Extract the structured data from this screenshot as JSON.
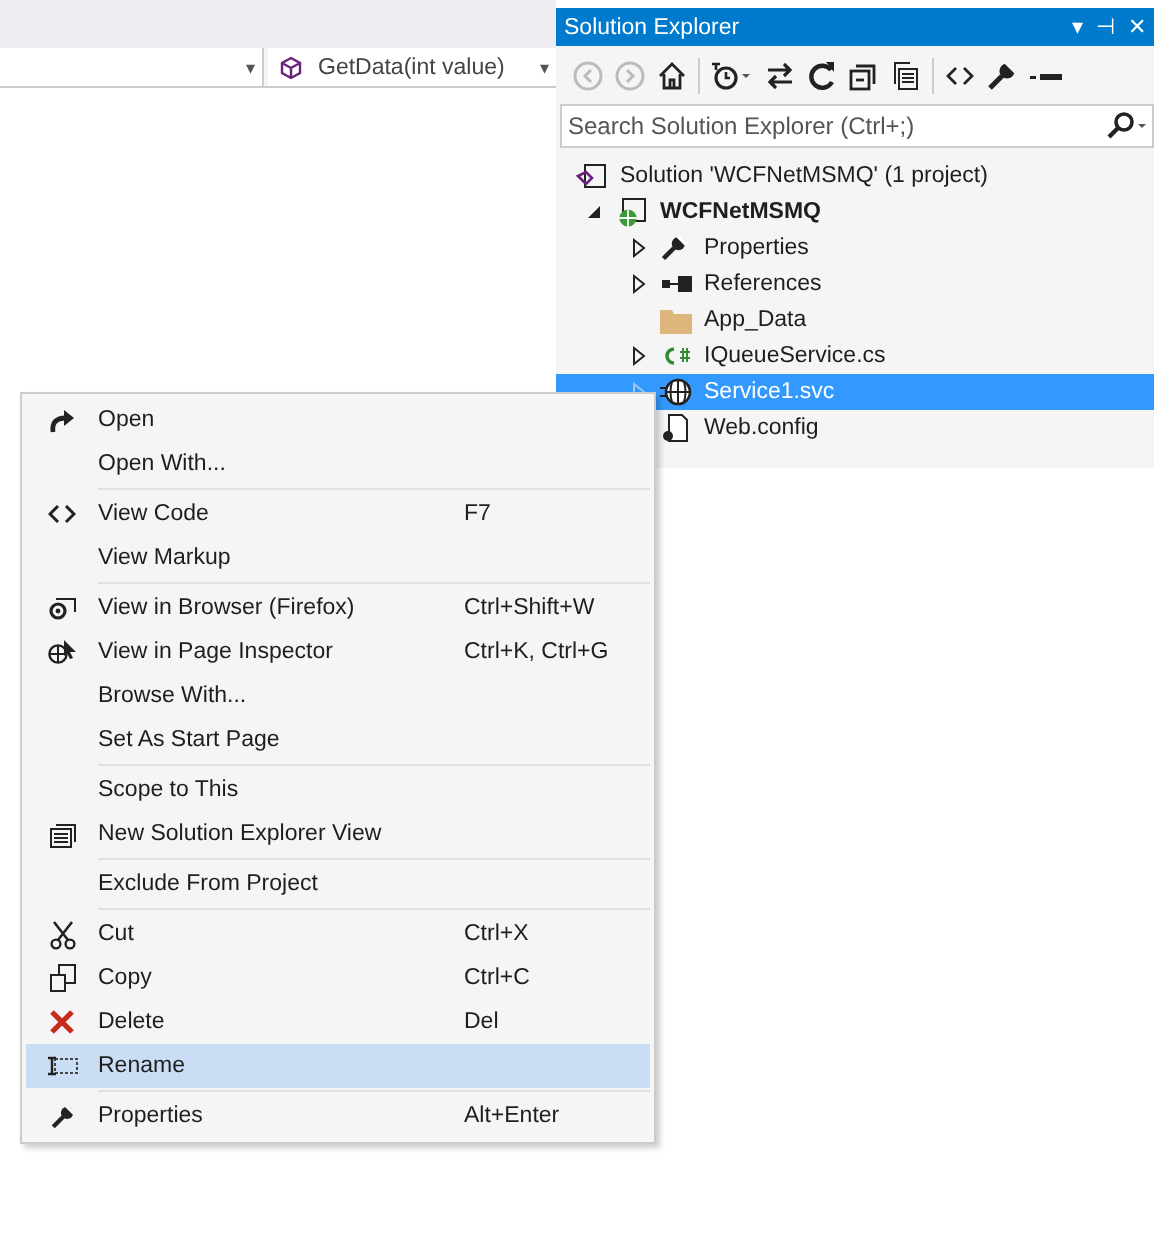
{
  "editor": {
    "nav_left": {
      "caret": "▾"
    },
    "nav_right": {
      "text": "GetData(int value)",
      "caret": "▾"
    }
  },
  "solution_explorer": {
    "title": "Solution Explorer",
    "title_buttons": [
      "▾",
      "⊣",
      "✕"
    ],
    "search": {
      "placeholder": "Search Solution Explorer (Ctrl+;)"
    },
    "tree": [
      {
        "label": "Solution 'WCFNetMSMQ' (1 project)",
        "bold": false,
        "selected": false,
        "children": [
          {
            "label": "WCFNetMSMQ",
            "bold": true,
            "selected": false,
            "expanded": true,
            "children": [
              {
                "label": "Properties",
                "bold": false,
                "selected": false,
                "expanded": false
              },
              {
                "label": "References",
                "bold": false,
                "selected": false,
                "expanded": false
              },
              {
                "label": "App_Data",
                "bold": false,
                "selected": false
              },
              {
                "label": "IQueueService.cs",
                "bold": false,
                "selected": false,
                "expanded": false
              },
              {
                "label": "Service1.svc",
                "bold": false,
                "selected": true,
                "expanded": false
              },
              {
                "label": "Web.config",
                "bold": false,
                "selected": false
              }
            ]
          }
        ]
      }
    ]
  },
  "context_menu": [
    [
      {
        "label": "Open",
        "selected": false
      },
      {
        "label": "Open With...",
        "selected": false
      }
    ],
    [
      {
        "label": "View Code",
        "shortcut": "F7",
        "selected": false
      },
      {
        "label": "View Markup",
        "selected": false
      }
    ],
    [
      {
        "label": "View in Browser (Firefox)",
        "shortcut": "Ctrl+Shift+W",
        "selected": false
      },
      {
        "label": "View in Page Inspector",
        "shortcut": "Ctrl+K, Ctrl+G",
        "selected": false
      },
      {
        "label": "Browse With...",
        "selected": false
      },
      {
        "label": "Set As Start Page",
        "selected": false
      }
    ],
    [
      {
        "label": "Scope to This",
        "selected": false
      },
      {
        "label": "New Solution Explorer View",
        "selected": false
      }
    ],
    [
      {
        "label": "Exclude From Project",
        "selected": false
      }
    ],
    [
      {
        "label": "Cut",
        "shortcut": "Ctrl+X",
        "selected": false
      },
      {
        "label": "Copy",
        "shortcut": "Ctrl+C",
        "selected": false
      },
      {
        "label": "Delete",
        "shortcut": "Del",
        "selected": false
      },
      {
        "label": "Rename",
        "selected": true
      }
    ],
    [
      {
        "label": "Properties",
        "shortcut": "Alt+Enter",
        "selected": false
      }
    ]
  ]
}
